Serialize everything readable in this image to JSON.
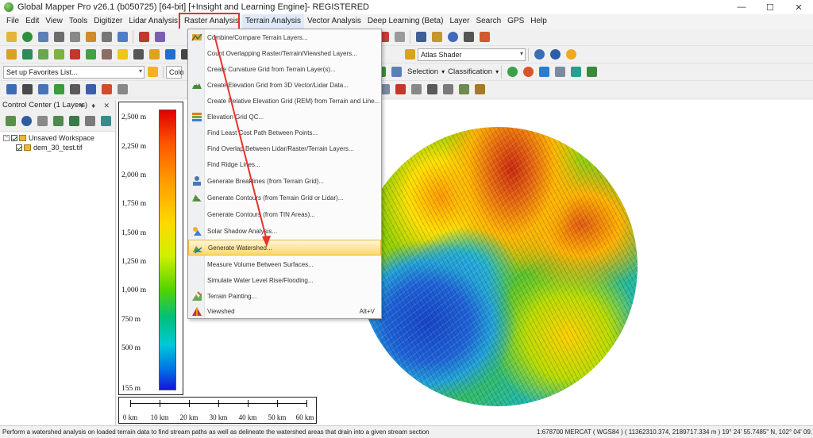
{
  "window": {
    "title": "Global Mapper Pro v26.1 (b050725) [64-bit] [+Insight and Learning Engine]- REGISTERED",
    "controls": [
      "—",
      "☐",
      "✕"
    ]
  },
  "menubar": {
    "items": [
      "File",
      "Edit",
      "View",
      "Tools",
      "Digitizer",
      "Lidar Analysis",
      "Raster Analysis",
      "Terrain Analysis",
      "Vector Analysis",
      "Deep Learning (Beta)",
      "Layer",
      "Search",
      "GPS",
      "Help"
    ],
    "active": "Terrain Analysis"
  },
  "toolbar": {
    "favorites_combo": "Set up Favorites List...",
    "color_combo_partial": "Colo",
    "shader_combo": "Atlas Shader",
    "selection_label": "Selection",
    "classification_label": "Classification"
  },
  "control_center": {
    "title": "Control Center (1 Layers)",
    "header_controls": "▾ ♦ ✕",
    "workspace_label": "Unsaved Workspace",
    "layer_label": "dem_30_test.tif"
  },
  "terrain_menu": {
    "items": [
      {
        "label": "Combine/Compare Terrain Layers...",
        "icon": "combine-terrain-icon"
      },
      {
        "label": "Count Overlapping Raster/Terrain/Viewshed Layers...",
        "icon": ""
      },
      {
        "label": "Create Curvature Grid from Terrain Layer(s)...",
        "icon": ""
      },
      {
        "label": "Create Elevation Grid from 3D Vector/Lidar Data...",
        "icon": "elevation-grid-icon"
      },
      {
        "label": "Create Relative Elevation Grid (REM) from Terrain and Line...",
        "icon": ""
      },
      {
        "label": "Elevation Grid QC...",
        "icon": "grid-qc-icon"
      },
      {
        "label": "Find Least Cost Path Between Points...",
        "icon": ""
      },
      {
        "label": "Find Overlap Between Lidar/Raster/Terrain Layers...",
        "icon": ""
      },
      {
        "label": "Find Ridge Lines...",
        "icon": ""
      },
      {
        "label": "Generate Breaklines (from Terrain Grid)...",
        "icon": "breaklines-icon"
      },
      {
        "label": "Generate Contours (from Terrain Grid or Lidar)...",
        "icon": "contours-icon"
      },
      {
        "label": "Generate Contours (from TIN Areas)...",
        "icon": ""
      },
      {
        "label": "Solar Shadow Analysis...",
        "icon": "solar-shadow-icon"
      },
      {
        "label": "Generate Watershed...",
        "icon": "watershed-icon",
        "highlighted": true
      },
      {
        "label": "Measure Volume Between Surfaces...",
        "icon": ""
      },
      {
        "label": "Simulate Water Level Rise/Flooding...",
        "icon": ""
      },
      {
        "label": "Terrain Painting...",
        "icon": "terrain-painting-icon"
      },
      {
        "label": "Viewshed",
        "icon": "viewshed-icon",
        "shortcut": "Alt+V"
      }
    ]
  },
  "legend": {
    "labels": [
      "2,500 m",
      "2,250 m",
      "2,000 m",
      "1,750 m",
      "1,500 m",
      "1,250 m",
      "1,000 m",
      "750 m",
      "500 m",
      "155 m"
    ],
    "color_top": "#e00000",
    "color_bottom": "#1515d8"
  },
  "scale_bar": {
    "labels": [
      "0 km",
      "10 km",
      "20 km",
      "30 km",
      "40 km",
      "50 km",
      "60 km"
    ]
  },
  "status": {
    "hint": "Perform a watershed analysis on loaded terrain data to find stream paths as well as delineate the watershed areas that drain into a given stream section",
    "coords": "1:678700  MERCAT ( WGS84 ) ( 11362310.374, 2189717.334 m )  19° 24' 55.7485\" N, 102° 04' 09.7346\" E"
  },
  "colors": {
    "annotation_red": "#e8322b",
    "menu_highlight": "#ffd769"
  }
}
